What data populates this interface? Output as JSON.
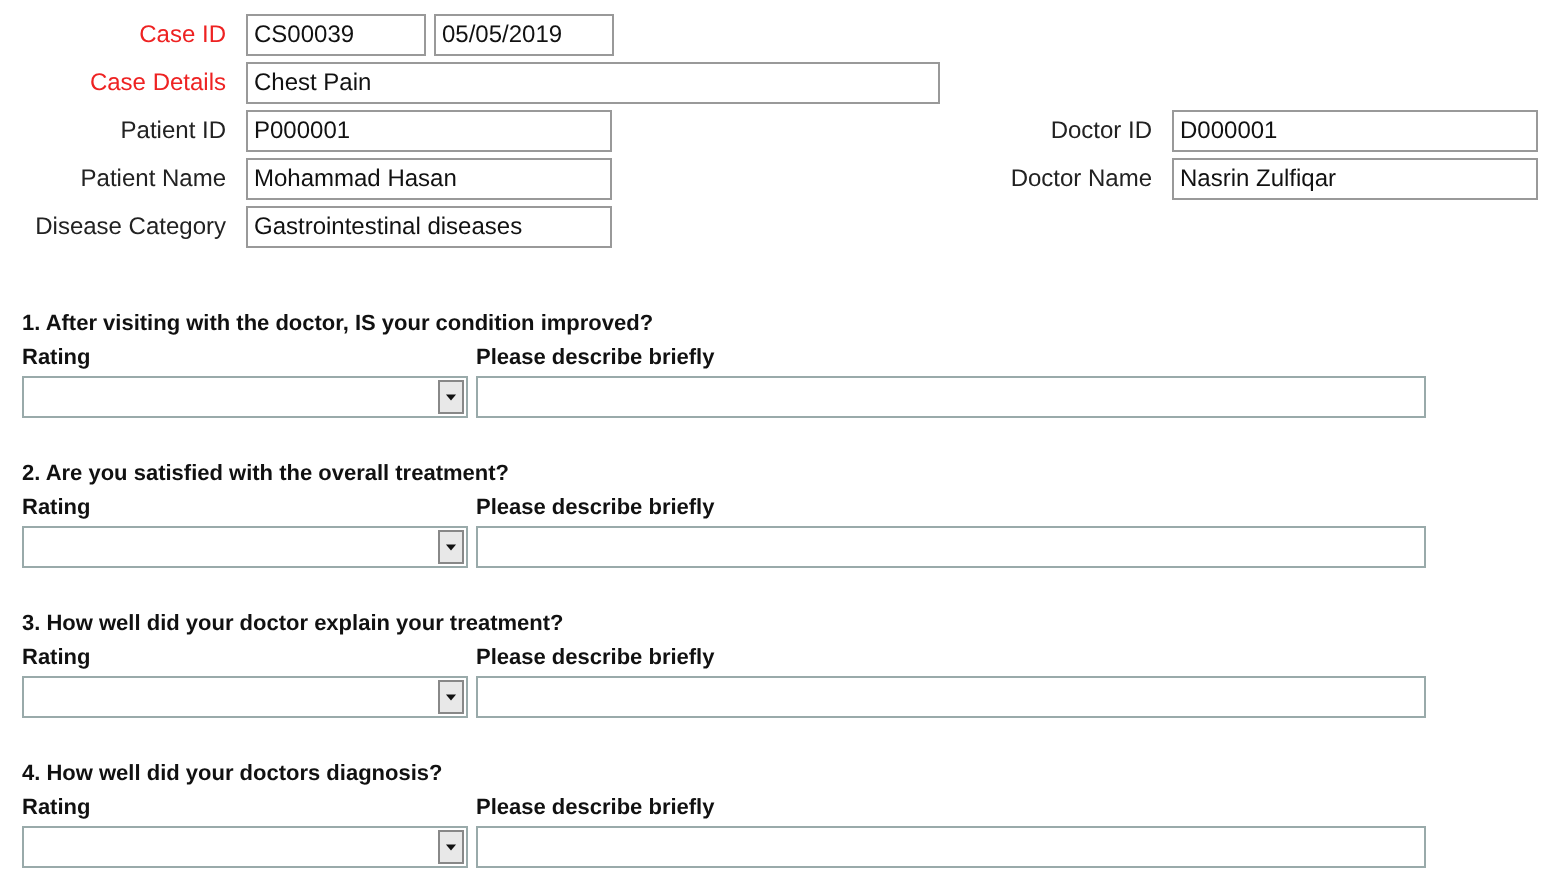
{
  "case_fields": [
    {
      "label": "Case ID",
      "required": true,
      "values": [
        "CS00039",
        "05/05/2019"
      ]
    },
    {
      "label": "Case Details",
      "required": true,
      "values": [
        "Chest Pain"
      ]
    },
    {
      "label": "Patient ID",
      "required": false,
      "values": [
        "P000001"
      ],
      "side": {
        "label": "Doctor ID",
        "value": "D000001"
      }
    },
    {
      "label": "Patient Name",
      "required": false,
      "values": [
        "Mohammad Hasan"
      ],
      "side": {
        "label": "Doctor Name",
        "value": "Nasrin Zulfiqar"
      }
    },
    {
      "label": "Disease Category",
      "required": false,
      "values": [
        "Gastrointestinal diseases"
      ]
    }
  ],
  "questions": [
    {
      "text": "1. After visiting with the doctor, IS your condition improved?",
      "rating_label": "Rating",
      "describe_label": "Please describe briefly"
    },
    {
      "text": "2. Are you satisfied with the overall treatment?",
      "rating_label": "Rating",
      "describe_label": "Please describe briefly"
    },
    {
      "text": "3. How well did your doctor explain your treatment?",
      "rating_label": "Rating",
      "describe_label": "Please describe briefly"
    },
    {
      "text": "4. How well did your doctors diagnosis?",
      "rating_label": "Rating",
      "describe_label": "Please describe briefly"
    }
  ]
}
